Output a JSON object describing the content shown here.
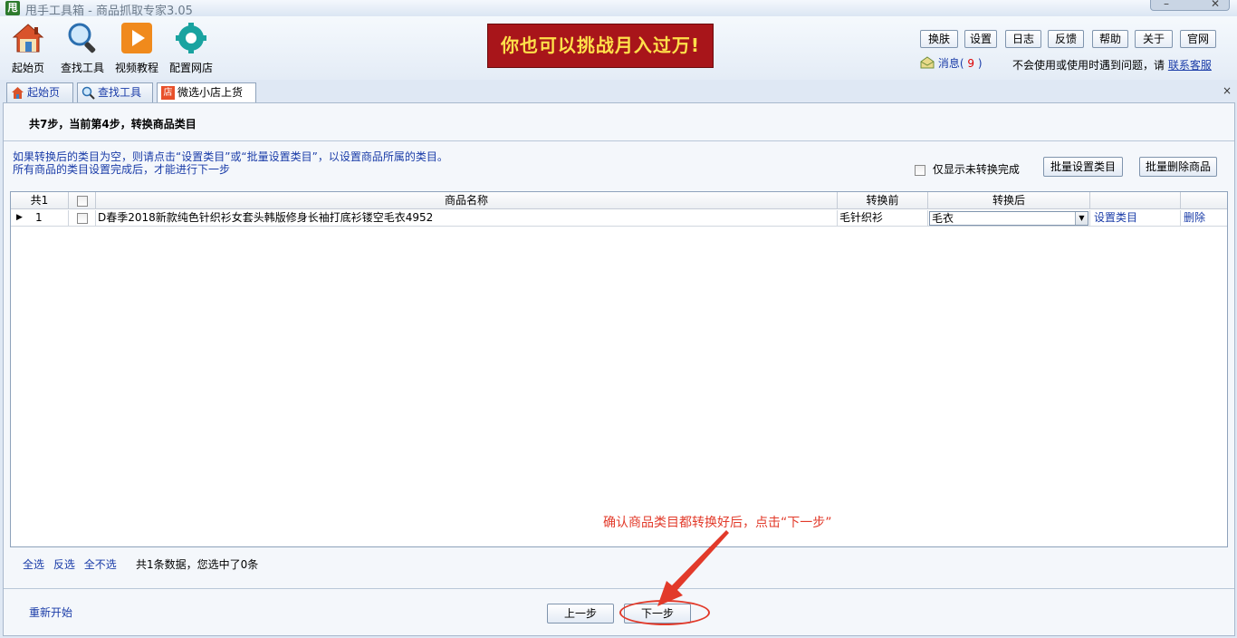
{
  "window": {
    "app_icon_text": "甩",
    "title": "甩手工具箱 - 商品抓取专家3.05",
    "btn_min": "–",
    "btn_close": "✕"
  },
  "toolbar": {
    "tools": [
      {
        "label": "起始页",
        "icon": "home-icon"
      },
      {
        "label": "查找工具",
        "icon": "magnifier-icon"
      },
      {
        "label": "视频教程",
        "icon": "play-icon"
      },
      {
        "label": "配置网店",
        "icon": "gear-icon"
      }
    ],
    "banner": "你也可以挑战月入过万!",
    "top_buttons": [
      "换肤",
      "设置",
      "日志",
      "反馈",
      "帮助",
      "关于",
      "官网"
    ],
    "message_label": "消息(",
    "message_count": "9",
    "message_close": ")",
    "help_text": "不会使用或使用时遇到问题，请",
    "help_link": "联系客服"
  },
  "tabs": [
    {
      "label": "起始页"
    },
    {
      "label": "查找工具"
    },
    {
      "label": "微选小店上货",
      "icon_text": "店"
    }
  ],
  "tab_close": "×",
  "step": {
    "title": "共7步，当前第4步，转换商品类目"
  },
  "notes": {
    "line1": "如果转换后的类目为空，则请点击“设置类目”或“批量设置类目”，以设置商品所属的类目。",
    "line2": "所有商品的类目设置完成后，才能进行下一步"
  },
  "filter": {
    "only_unconverted_label": "仅显示未转换完成"
  },
  "actions": {
    "batch_set_category": "批量设置类目",
    "batch_delete": "批量删除商品"
  },
  "grid": {
    "headers": {
      "count": "共1",
      "product_name": "商品名称",
      "before": "转换前",
      "after": "转换后"
    },
    "rows": [
      {
        "index": "1",
        "name": "D春季2018新款纯色针织衫女套头韩版修身长袖打底衫镂空毛衣4952",
        "before": "毛针织衫",
        "after": "毛衣",
        "set_category": "设置类目",
        "delete": "删除"
      }
    ]
  },
  "footer": {
    "select_all": "全选",
    "invert": "反选",
    "select_none": "全不选",
    "summary": "共1条数据，您选中了0条",
    "restart": "重新开始",
    "prev": "上一步",
    "next": "下一步"
  },
  "annotation": {
    "text": "确认商品类目都转换好后，点击“下一步”",
    "color": "#e23a2a"
  },
  "colors": {
    "link": "#1a3ca8",
    "banner_bg": "#a8151a",
    "banner_text": "#ffe04a"
  }
}
